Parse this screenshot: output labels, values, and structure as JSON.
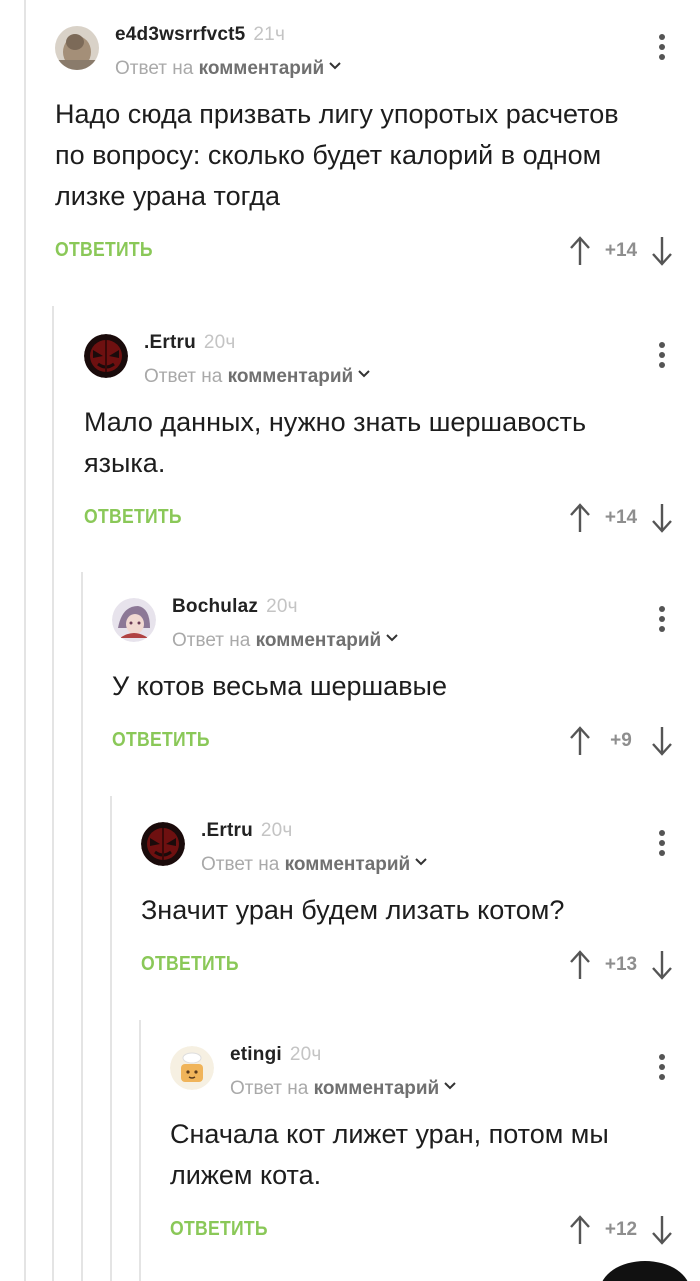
{
  "reply_to_prefix": "Ответ на",
  "reply_to_target": "комментарий",
  "reply_label": "ОТВЕТИТЬ",
  "comments": [
    {
      "author": "e4d3wsrrfvct5",
      "time": "21ч",
      "text_lines": [
        "Надо сюда призвать лигу упоротых расчетов",
        "по вопросу: сколько будет калорий в одном",
        "лизке урана тогда"
      ],
      "score": "+14",
      "avatar_icon": "photo-avatar-icon"
    },
    {
      "author": ".Ertru",
      "time": "20ч",
      "text_lines": [
        "Мало данных, нужно знать шершавость",
        "языка."
      ],
      "score": "+14",
      "avatar_icon": "red-mask-avatar-icon"
    },
    {
      "author": "Bochulaz",
      "time": "20ч",
      "text_lines": [
        "У котов весьма шершавые"
      ],
      "score": "+9",
      "avatar_icon": "anime-avatar-icon"
    },
    {
      "author": ".Ertru",
      "time": "20ч",
      "text_lines": [
        "Значит уран будем лизать котом?"
      ],
      "score": "+13",
      "avatar_icon": "red-mask-avatar-icon"
    },
    {
      "author": "etingi",
      "time": "20ч",
      "text_lines": [
        "Сначала кот лижет уран, потом мы",
        "лижем кота."
      ],
      "score": "+12",
      "avatar_icon": "cat-cartoon-avatar-icon"
    }
  ],
  "colors": {
    "accent_green": "#8ac858",
    "thread_line": "#e4e4e4",
    "muted_text": "#a9a9a9",
    "score_text": "#8e8e8e"
  }
}
